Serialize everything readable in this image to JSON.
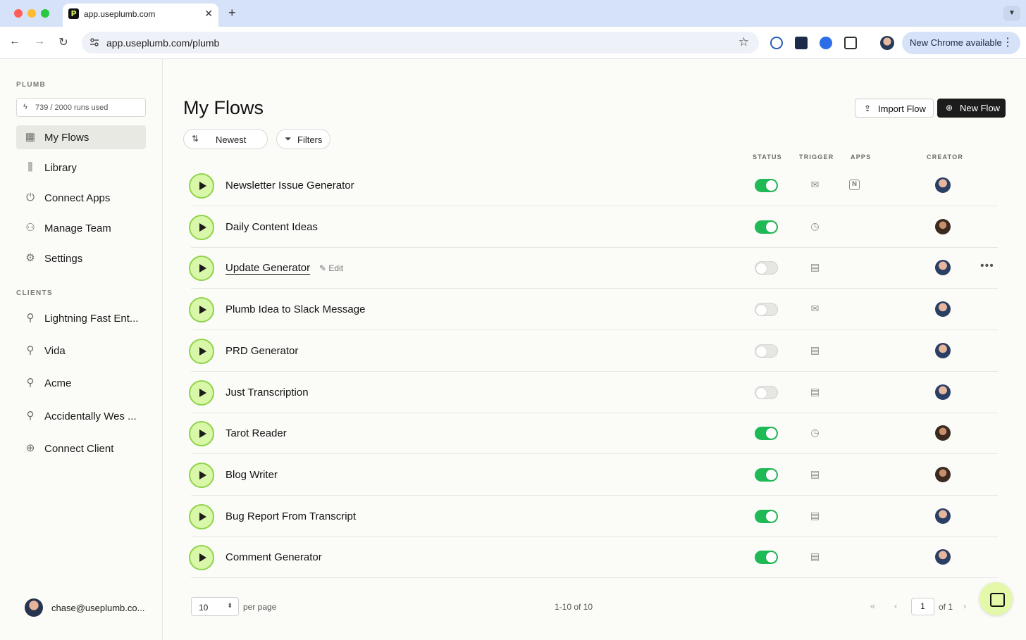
{
  "browser": {
    "tab_title": "app.useplumb.com",
    "url": "app.useplumb.com/plumb",
    "update_label": "New Chrome available"
  },
  "sidebar": {
    "workspace_label": "PLUMB",
    "runs_used": "739 / 2000 runs used",
    "nav": [
      {
        "label": "My Flows",
        "icon": "grid-icon",
        "active": true
      },
      {
        "label": "Library",
        "icon": "library-icon"
      },
      {
        "label": "Connect Apps",
        "icon": "plug-icon"
      },
      {
        "label": "Manage Team",
        "icon": "team-icon"
      },
      {
        "label": "Settings",
        "icon": "gear-icon"
      }
    ],
    "clients_label": "CLIENTS",
    "clients": [
      {
        "label": "Lightning Fast Ent..."
      },
      {
        "label": "Vida"
      },
      {
        "label": "Acme"
      },
      {
        "label": "Accidentally Wes ..."
      },
      {
        "label": "Connect Client"
      }
    ],
    "user_email": "chase@useplumb.co..."
  },
  "main": {
    "title": "My Flows",
    "import_label": "Import Flow",
    "new_label": "New Flow",
    "sort_label": "Newest",
    "filter_label": "Filters",
    "columns": {
      "status": "STATUS",
      "trigger": "TRIGGER",
      "apps": "APPS",
      "creator": "CREATOR"
    },
    "edit_label": "Edit",
    "flows": [
      {
        "name": "Newsletter Issue Generator",
        "enabled": true,
        "trigger": "email-icon",
        "app": "notion-icon",
        "creator": "a"
      },
      {
        "name": "Daily Content Ideas",
        "enabled": true,
        "trigger": "clock-icon",
        "creator": "b"
      },
      {
        "name": "Update Generator",
        "enabled": false,
        "trigger": "form-icon",
        "creator": "a",
        "editing": true
      },
      {
        "name": "Plumb Idea to Slack Message",
        "enabled": false,
        "trigger": "email-icon",
        "creator": "a"
      },
      {
        "name": "PRD Generator",
        "enabled": false,
        "trigger": "form-icon",
        "creator": "a"
      },
      {
        "name": "Just Transcription",
        "enabled": false,
        "trigger": "form-icon",
        "creator": "a"
      },
      {
        "name": "Tarot Reader",
        "enabled": true,
        "trigger": "clock-icon",
        "creator": "b"
      },
      {
        "name": "Blog Writer",
        "enabled": true,
        "trigger": "form-icon",
        "creator": "b"
      },
      {
        "name": "Bug Report From Transcript",
        "enabled": true,
        "trigger": "form-icon",
        "creator": "a"
      },
      {
        "name": "Comment Generator",
        "enabled": true,
        "trigger": "form-icon",
        "creator": "a"
      }
    ]
  },
  "pagination": {
    "per_page_value": "10",
    "per_page_label": "per page",
    "range": "1-10 of 10",
    "page": "1",
    "of_pages": "of 1"
  },
  "colors": {
    "accent_green": "#1fb955",
    "play_bg": "#d9f7a8",
    "primary_button": "#1c1c1c"
  }
}
